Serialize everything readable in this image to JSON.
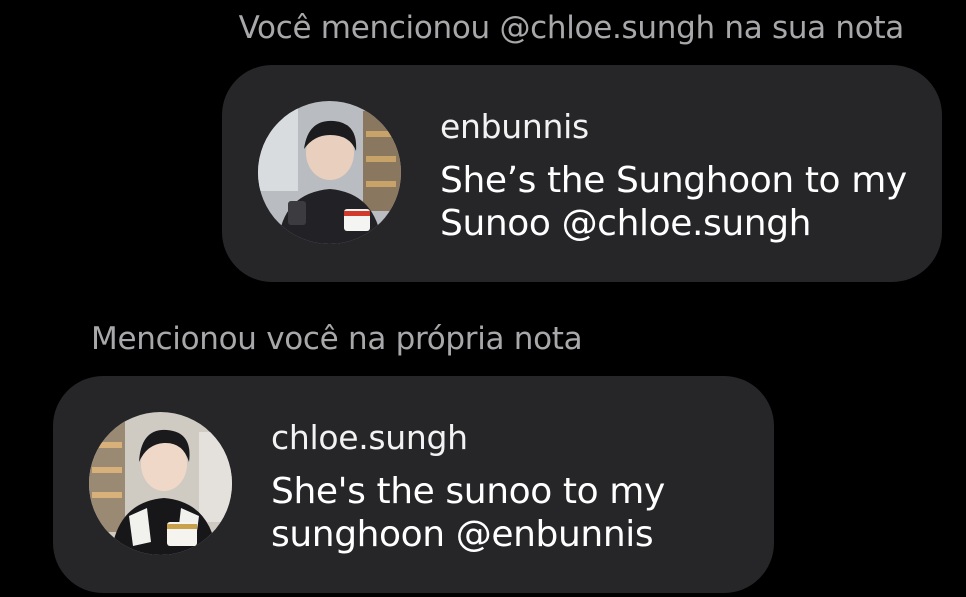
{
  "sent_note": {
    "caption": "Você mencionou @chloe.sungh na sua nota",
    "username": "enbunnis",
    "message_line1": "She’s the Sunghoon to my",
    "message_line2": "Sunoo @chloe.sungh"
  },
  "received_note": {
    "caption": "Mencionou você na própria nota",
    "username": "chloe.sungh",
    "message_line1": "She's the sunoo to my",
    "message_line2": "sunghoon @enbunnis"
  },
  "colors": {
    "background": "#000000",
    "bubble": "#262629",
    "caption": "#a8a8ab",
    "text": "#ffffff"
  }
}
